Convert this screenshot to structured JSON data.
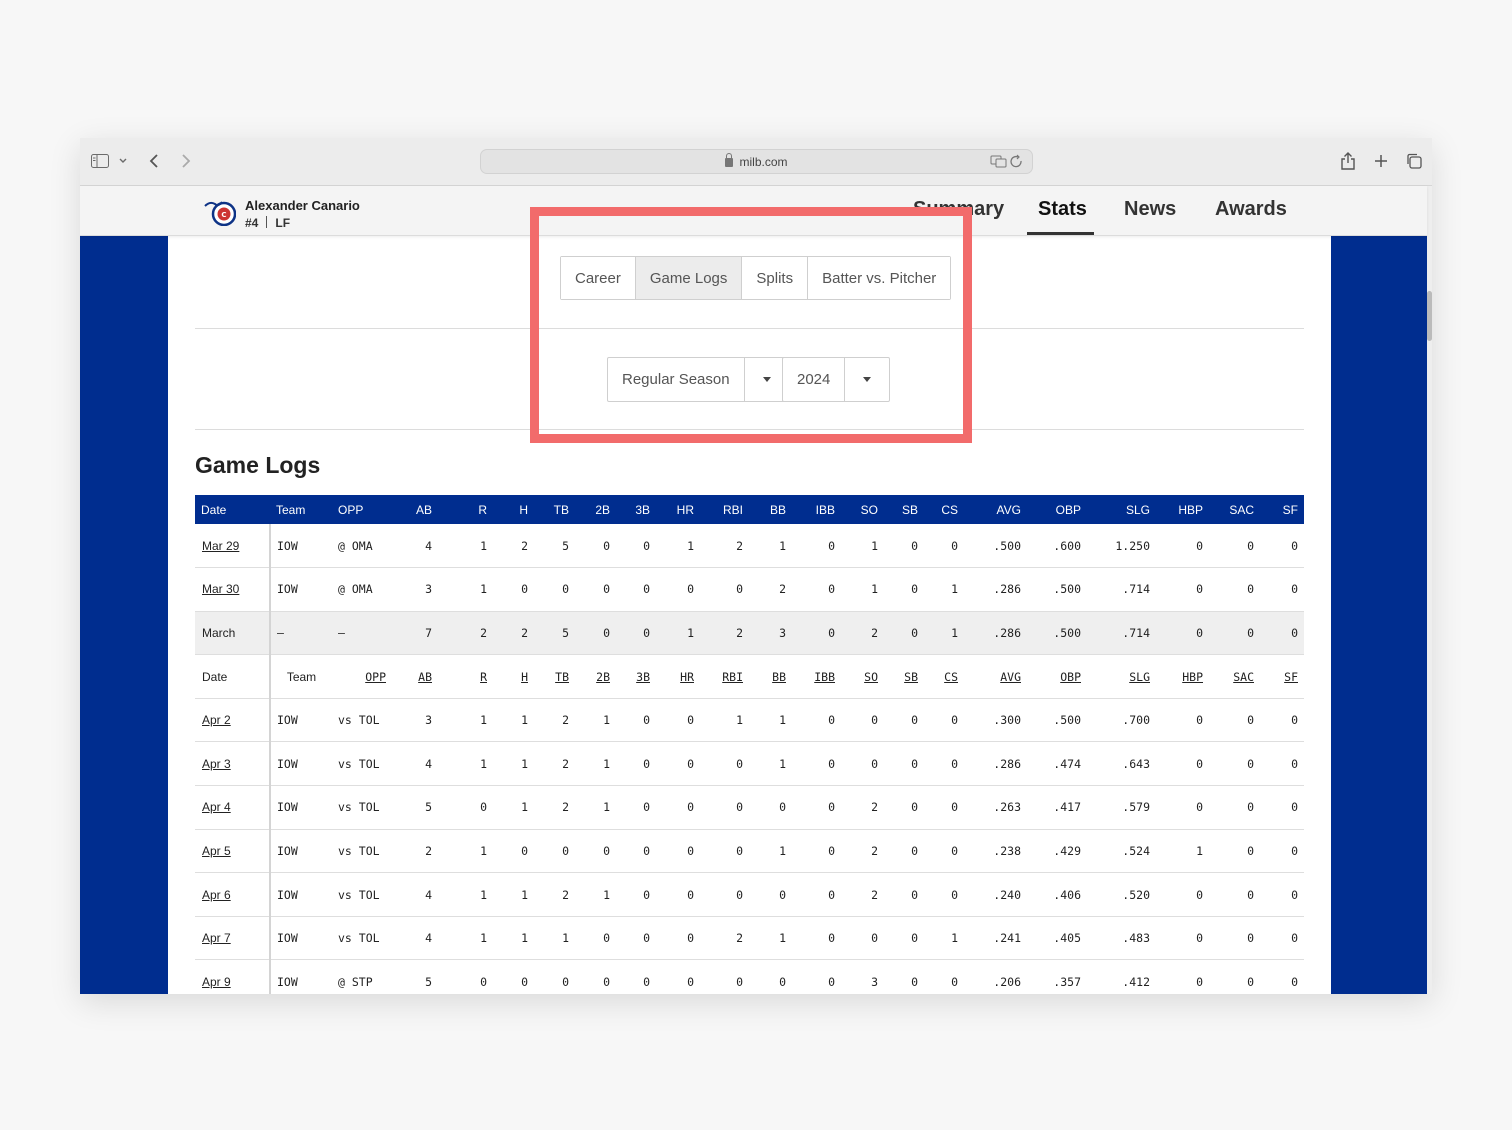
{
  "browser": {
    "url": "milb.com"
  },
  "player": {
    "name": "Alexander Canario",
    "number": "#4",
    "position": "LF",
    "team_logo": "iowa-cubs-logo"
  },
  "nav": {
    "items": [
      "Summary",
      "Stats",
      "News",
      "Awards"
    ],
    "active": "Stats"
  },
  "stats_tabs": {
    "items": [
      "Career",
      "Game Logs",
      "Splits",
      "Batter vs. Pitcher"
    ],
    "active": "Game Logs"
  },
  "filters": {
    "season_type": "Regular Season",
    "year": "2024"
  },
  "game_logs": {
    "title": "Game Logs",
    "columns": [
      "Date",
      "Team",
      "OPP",
      "AB",
      "R",
      "H",
      "TB",
      "2B",
      "3B",
      "HR",
      "RBI",
      "BB",
      "IBB",
      "SO",
      "SB",
      "CS",
      "AVG",
      "OBP",
      "SLG",
      "HBP",
      "SAC",
      "SF"
    ],
    "rows": [
      {
        "type": "game",
        "cells": [
          "Mar 29",
          "IOW",
          "@ OMA",
          "4",
          "1",
          "2",
          "5",
          "0",
          "0",
          "1",
          "2",
          "1",
          "0",
          "1",
          "0",
          "0",
          ".500",
          ".600",
          "1.250",
          "0",
          "0",
          "0"
        ]
      },
      {
        "type": "game",
        "cells": [
          "Mar 30",
          "IOW",
          "@ OMA",
          "3",
          "1",
          "0",
          "0",
          "0",
          "0",
          "0",
          "0",
          "2",
          "0",
          "1",
          "0",
          "1",
          ".286",
          ".500",
          ".714",
          "0",
          "0",
          "0"
        ]
      },
      {
        "type": "summary",
        "cells": [
          "March",
          "–",
          "–",
          "7",
          "2",
          "2",
          "5",
          "0",
          "0",
          "1",
          "2",
          "3",
          "0",
          "2",
          "0",
          "1",
          ".286",
          ".500",
          ".714",
          "0",
          "0",
          "0"
        ]
      },
      {
        "type": "subhead",
        "cells": [
          "Date",
          "Team",
          "OPP",
          "AB",
          "R",
          "H",
          "TB",
          "2B",
          "3B",
          "HR",
          "RBI",
          "BB",
          "IBB",
          "SO",
          "SB",
          "CS",
          "AVG",
          "OBP",
          "SLG",
          "HBP",
          "SAC",
          "SF"
        ]
      },
      {
        "type": "game",
        "cells": [
          "Apr 2",
          "IOW",
          "vs TOL",
          "3",
          "1",
          "1",
          "2",
          "1",
          "0",
          "0",
          "1",
          "1",
          "0",
          "0",
          "0",
          "0",
          ".300",
          ".500",
          ".700",
          "0",
          "0",
          "0"
        ]
      },
      {
        "type": "game",
        "cells": [
          "Apr 3",
          "IOW",
          "vs TOL",
          "4",
          "1",
          "1",
          "2",
          "1",
          "0",
          "0",
          "0",
          "1",
          "0",
          "0",
          "0",
          "0",
          ".286",
          ".474",
          ".643",
          "0",
          "0",
          "0"
        ]
      },
      {
        "type": "game",
        "cells": [
          "Apr 4",
          "IOW",
          "vs TOL",
          "5",
          "0",
          "1",
          "2",
          "1",
          "0",
          "0",
          "0",
          "0",
          "0",
          "2",
          "0",
          "0",
          ".263",
          ".417",
          ".579",
          "0",
          "0",
          "0"
        ]
      },
      {
        "type": "game",
        "cells": [
          "Apr 5",
          "IOW",
          "vs TOL",
          "2",
          "1",
          "0",
          "0",
          "0",
          "0",
          "0",
          "0",
          "1",
          "0",
          "2",
          "0",
          "0",
          ".238",
          ".429",
          ".524",
          "1",
          "0",
          "0"
        ]
      },
      {
        "type": "game",
        "cells": [
          "Apr 6",
          "IOW",
          "vs TOL",
          "4",
          "1",
          "1",
          "2",
          "1",
          "0",
          "0",
          "0",
          "0",
          "0",
          "2",
          "0",
          "0",
          ".240",
          ".406",
          ".520",
          "0",
          "0",
          "0"
        ]
      },
      {
        "type": "game",
        "cells": [
          "Apr 7",
          "IOW",
          "vs TOL",
          "4",
          "1",
          "1",
          "1",
          "0",
          "0",
          "0",
          "2",
          "1",
          "0",
          "0",
          "0",
          "1",
          ".241",
          ".405",
          ".483",
          "0",
          "0",
          "0"
        ]
      },
      {
        "type": "game",
        "cells": [
          "Apr 9",
          "IOW",
          "@ STP",
          "5",
          "0",
          "0",
          "0",
          "0",
          "0",
          "0",
          "0",
          "0",
          "0",
          "3",
          "0",
          "0",
          ".206",
          ".357",
          ".412",
          "0",
          "0",
          "0"
        ]
      }
    ]
  },
  "colors": {
    "brand_blue": "#002d8f",
    "highlight": "#f26b6b"
  }
}
